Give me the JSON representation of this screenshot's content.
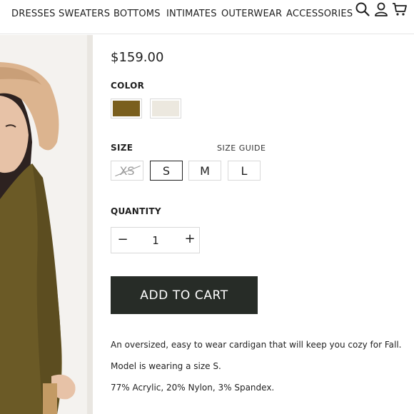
{
  "nav": {
    "items": [
      "DRESSES",
      "SWEATERS",
      "BOTTOMS",
      "INTIMATES",
      "OUTERWEAR",
      "ACCESSORIES"
    ],
    "icons": [
      "search-icon",
      "account-icon",
      "cart-icon"
    ]
  },
  "product": {
    "price": "$159.00",
    "color_label": "COLOR",
    "colors": [
      "#7a5f1e",
      "#ece8df"
    ],
    "size_label": "SIZE",
    "size_guide": "SIZE GUIDE",
    "sizes": [
      "XS",
      "S",
      "M",
      "L"
    ],
    "selected_size": "S",
    "unavailable_sizes": [
      "XS"
    ],
    "quantity_label": "QUANTITY",
    "quantity_minus": "−",
    "quantity": "1",
    "quantity_plus": "+",
    "add_to_cart": "ADD TO CART",
    "description": [
      "An oversized, easy to wear cardigan that will keep you cozy for Fall.",
      "Model is wearing a size S.",
      "77% Acrylic, 20% Nylon, 3% Spandex."
    ]
  },
  "colors": {
    "button_bg": "#272c27",
    "cardigan": "#6b5a26",
    "hat": "#dcb48f"
  }
}
